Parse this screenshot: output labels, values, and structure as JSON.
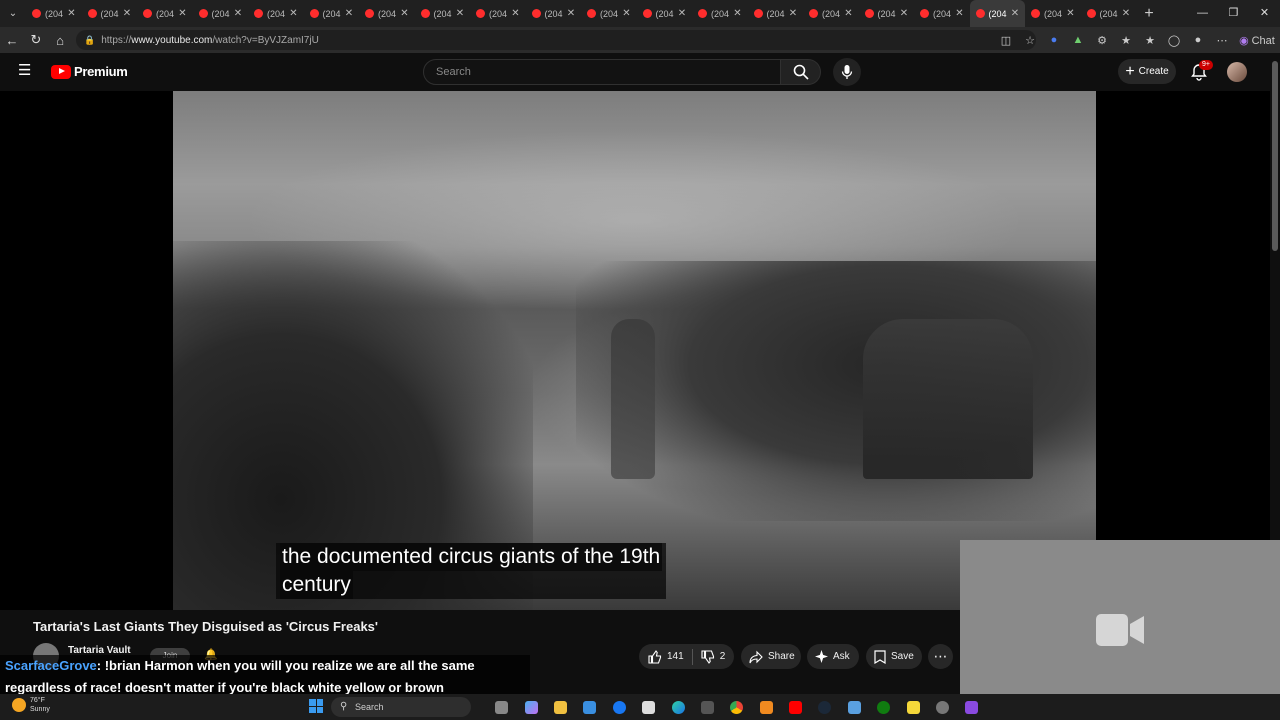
{
  "browser": {
    "tab_label": "(204",
    "tab_count": 20,
    "active_tab_index": 17,
    "url_prefix": "https://",
    "url_host": "www.youtube.com",
    "url_path": "/watch?v=ByVJZamI7jU",
    "chat_label": "Chat"
  },
  "header": {
    "logo_text": "Premium",
    "search_placeholder": "Search",
    "create_label": "Create",
    "notifications_badge": "9+"
  },
  "video": {
    "caption_line1": "the documented circus giants of the 19th",
    "caption_line2": "century",
    "title": "Tartaria's Last Giants They Disguised as 'Circus Freaks'",
    "channel_name": "Tartaria Vault",
    "join_label": "Join"
  },
  "actions": {
    "likes": "141",
    "dislikes": "2",
    "share_label": "Share",
    "ask_label": "Ask",
    "save_label": "Save"
  },
  "chat_overlay": {
    "user": "ScarfaceGrove",
    "message_line1": ": !brian Harmon when you will you realize we are all the same",
    "message_line2": "regardless of race! doesn't matter if you're black white yellow or brown"
  },
  "taskbar": {
    "temperature": "76°F",
    "condition": "Sunny",
    "search_label": "Search"
  },
  "colors": {
    "brand_red": "#ff0000",
    "link_blue": "#4aa3ff"
  }
}
